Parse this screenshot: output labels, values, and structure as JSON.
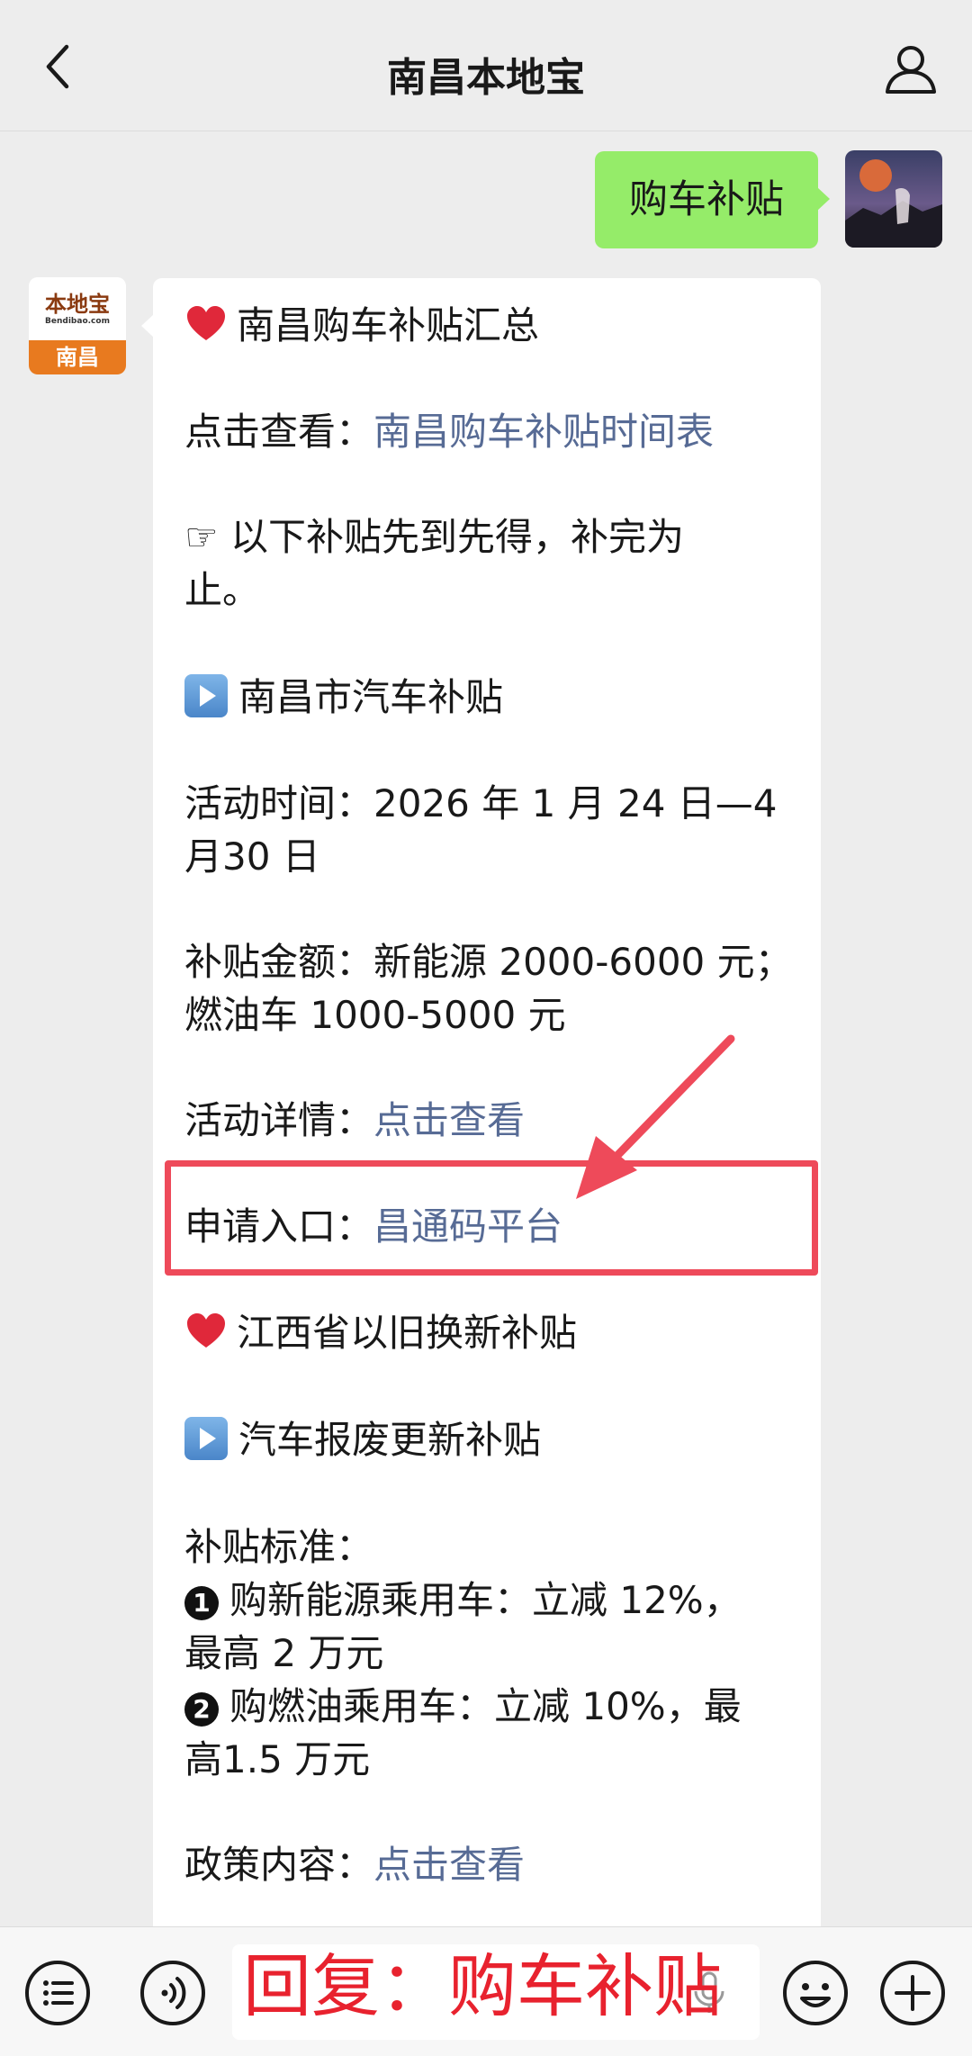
{
  "header": {
    "title": "南昌本地宝"
  },
  "user_message": {
    "text": "购车补贴"
  },
  "bot_avatar": {
    "logo_text": "本地宝",
    "logo_sub": "Bendibao.com",
    "city": "南昌"
  },
  "bot_message": {
    "heading1": "南昌购车补贴汇总",
    "check_label": "点击查看：",
    "check_link": "南昌购车补贴时间表",
    "notice_l1": "☞ 以下补贴先到先得，补完为",
    "notice_l2": "止。",
    "section1": "南昌市汽车补贴",
    "time_l1": "活动时间：2026 年 1 月 24 日—4",
    "time_l2": "月30 日",
    "amount_l1": "补贴金额：新能源 2000-6000 元；",
    "amount_l2": "燃油车 1000-5000 元",
    "detail_label": "活动详情：",
    "detail_link": "点击查看",
    "apply_label": "申请入口：",
    "apply_link": "昌通码平台",
    "heading2": "江西省以旧换新补贴",
    "section2": "汽车报废更新补贴",
    "standard_label": "补贴标准：",
    "item1_num": "1",
    "item1_l1": "购新能源乘用车：立减 12%，",
    "item1_l2": "最高 2 万元",
    "item2_num": "2",
    "item2_l1": "购燃油乘用车：立减 10%，最",
    "item2_l2": "高1.5 万元",
    "policy_label": "政策内容：",
    "policy_link": "点击查看"
  },
  "bottom_bar": {
    "overlay_text": "回复：购车补贴"
  },
  "colors": {
    "link": "#576b95",
    "user_bubble": "#95ec69",
    "highlight": "#ee4a5a",
    "background": "#ededed"
  }
}
